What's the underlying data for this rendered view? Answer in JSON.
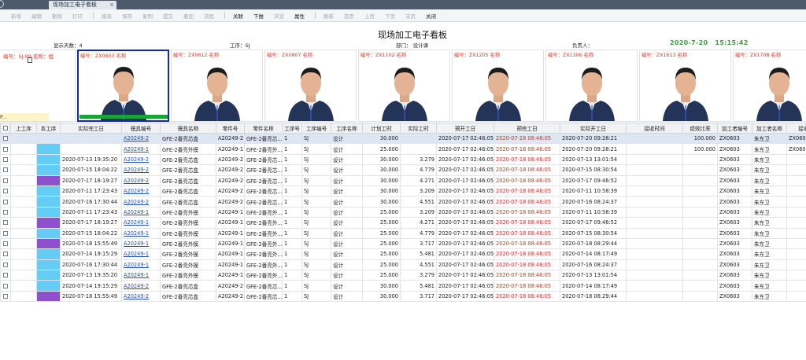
{
  "window": {
    "tab_title": "现场加工电子看板",
    "tab_close": "×"
  },
  "toolbar": {
    "items": [
      {
        "label": "新增",
        "enabled": false
      },
      {
        "label": "编辑",
        "enabled": false
      },
      {
        "label": "删除",
        "enabled": false
      },
      {
        "label": "打印",
        "enabled": false
      },
      {
        "label": "报表",
        "enabled": false
      },
      {
        "label": "保存",
        "enabled": false
      },
      {
        "label": "复制",
        "enabled": false
      },
      {
        "label": "提交",
        "enabled": false
      },
      {
        "label": "撤回",
        "enabled": false
      },
      {
        "label": "流程",
        "enabled": false
      },
      {
        "label": "关联",
        "enabled": true
      },
      {
        "label": "下推",
        "enabled": true
      },
      {
        "label": "浏览",
        "enabled": false
      },
      {
        "label": "属性",
        "enabled": true
      },
      {
        "label": "刷新",
        "enabled": false
      },
      {
        "label": "首页",
        "enabled": false
      },
      {
        "label": "上页",
        "enabled": false
      },
      {
        "label": "下页",
        "enabled": false
      },
      {
        "label": "末页",
        "enabled": false
      },
      {
        "label": "关闭",
        "enabled": true
      }
    ]
  },
  "board": {
    "title": "现场加工电子看板",
    "display_days": "显示天数：4",
    "process": "工序：SJ",
    "department": "部门：  设计课",
    "manager": "负责人：",
    "clock_date": "2020-7-20",
    "clock_time": "15:15:42"
  },
  "employees": [
    {
      "label": "编号：SJ-99 名称：组",
      "bottom_text": "P..."
    },
    {
      "label": "编号：ZX0603 名称",
      "selected": true
    },
    {
      "label": "编号：ZX0612 名称"
    },
    {
      "label": "编号：ZX0807 名称"
    },
    {
      "label": "编号：ZX1102 名称"
    },
    {
      "label": "编号：ZX1205 名称"
    },
    {
      "label": "编号：ZX1306 名称"
    },
    {
      "label": "编号：ZX1613 名称"
    },
    {
      "label": "编号：ZX1708 名称"
    }
  ],
  "table": {
    "columns": [
      "",
      "上工序",
      "本工序",
      "实际完工日",
      "模具编号",
      "模具名称",
      "零件号",
      "零件名称",
      "工序号",
      "工序编号",
      "工序名称",
      "计划工时",
      "实际工时",
      "预开工日",
      "预完工日",
      "实际开工日",
      "接收时间",
      "绩效比率",
      "加工者编号",
      "加工者名称",
      "接收人"
    ],
    "rows": [
      {
        "color": "purple",
        "done": "",
        "mold": "A20249-2",
        "mold_name": "GFE-2番亮芯盒",
        "part": "A20249-2",
        "part_name": "GFE-2番亮芯...",
        "seq": "1",
        "op_code": "SJ",
        "op_name": "设计",
        "plan": "30.000",
        "actual": "",
        "pre_start": "2020-07-17 02:46:05",
        "pre_end": "2020-07-18 08:46:05",
        "act_start": "2020-07-20 09:28:21",
        "recv": "",
        "ratio": "100.000",
        "worker_id": "ZX0603",
        "worker": "朱东卫",
        "receiver": "ZX060"
      },
      {
        "color": "cyan",
        "done": "",
        "mold": "A20249-1",
        "mold_name": "GFE-2番亮外模",
        "part": "A20249-1",
        "part_name": "GFE-2番亮外...",
        "seq": "1",
        "op_code": "SJ",
        "op_name": "设计",
        "plan": "25.000",
        "actual": "",
        "pre_start": "2020-07-17 02:46:05",
        "pre_end": "2020-07-18 08:46:05",
        "act_start": "2020-07-20 09:28:21",
        "recv": "",
        "ratio": "100.000",
        "worker_id": "ZX0603",
        "worker": "朱东卫",
        "receiver": "ZX060"
      },
      {
        "color": "cyan",
        "done": "2020-07-13 19:35:20",
        "mold": "A20249-2",
        "mold_name": "GFE-2番亮芯盒",
        "part": "A20249-2",
        "part_name": "GFE-2番亮芯...",
        "seq": "1",
        "op_code": "SJ",
        "op_name": "设计",
        "plan": "30.000",
        "actual": "3.279",
        "pre_start": "2020-07-17 02:46:05",
        "pre_end": "2020-07-18 08:46:05",
        "act_start": "2020-07-13 13:01:54",
        "recv": "",
        "ratio": "",
        "worker_id": "ZX0603",
        "worker": "朱东卫",
        "receiver": ""
      },
      {
        "color": "cyan",
        "done": "2020-07-15 18:04:22",
        "mold": "A20249-2",
        "mold_name": "GFE-2番亮芯盒",
        "part": "A20249-2",
        "part_name": "GFE-2番亮芯...",
        "seq": "1",
        "op_code": "SJ",
        "op_name": "设计",
        "plan": "30.000",
        "actual": "4.779",
        "pre_start": "2020-07-17 02:46:05",
        "pre_end": "2020-07-18 08:46:05",
        "act_start": "2020-07-15 08:30:54",
        "recv": "",
        "ratio": "",
        "worker_id": "ZX0603",
        "worker": "朱东卫",
        "receiver": ""
      },
      {
        "color": "purple",
        "done": "2020-07-17 18:19:27",
        "mold": "A20249-2",
        "mold_name": "GFE-2番亮芯盒",
        "part": "A20249-2",
        "part_name": "GFE-2番亮芯...",
        "seq": "1",
        "op_code": "SJ",
        "op_name": "设计",
        "plan": "30.000",
        "actual": "4.271",
        "pre_start": "2020-07-17 02:46:05",
        "pre_end": "2020-07-18 08:46:05",
        "act_start": "2020-07-17 09:46:52",
        "recv": "",
        "ratio": "",
        "worker_id": "ZX0603",
        "worker": "朱东卫",
        "receiver": ""
      },
      {
        "color": "cyan",
        "done": "2020-07-11 17:23:43",
        "mold": "A20249-2",
        "mold_name": "GFE-2番亮芯盒",
        "part": "A20249-2",
        "part_name": "GFE-2番亮芯...",
        "seq": "1",
        "op_code": "SJ",
        "op_name": "设计",
        "plan": "30.000",
        "actual": "3.209",
        "pre_start": "2020-07-17 02:46:05",
        "pre_end": "2020-07-18 08:46:05",
        "act_start": "2020-07-11 10:58:39",
        "recv": "",
        "ratio": "",
        "worker_id": "ZX0603",
        "worker": "朱东卫",
        "receiver": ""
      },
      {
        "color": "cyan",
        "done": "2020-07-16 17:30:44",
        "mold": "A20249-2",
        "mold_name": "GFE-2番亮芯盒",
        "part": "A20249-2",
        "part_name": "GFE-2番亮芯...",
        "seq": "1",
        "op_code": "SJ",
        "op_name": "设计",
        "plan": "30.000",
        "actual": "4.551",
        "pre_start": "2020-07-17 02:46:05",
        "pre_end": "2020-07-18 08:46:05",
        "act_start": "2020-07-16 08:24:37",
        "recv": "",
        "ratio": "",
        "worker_id": "ZX0603",
        "worker": "朱东卫",
        "receiver": ""
      },
      {
        "color": "cyan",
        "done": "2020-07-11 17:23:43",
        "mold": "A20249-1",
        "mold_name": "GFE-2番亮外模",
        "part": "A20249-1",
        "part_name": "GFE-2番亮外...",
        "seq": "1",
        "op_code": "SJ",
        "op_name": "设计",
        "plan": "25.000",
        "actual": "3.209",
        "pre_start": "2020-07-17 02:46:05",
        "pre_end": "2020-07-18 08:46:05",
        "act_start": "2020-07-11 10:58:39",
        "recv": "",
        "ratio": "",
        "worker_id": "ZX0603",
        "worker": "朱东卫",
        "receiver": ""
      },
      {
        "color": "purple",
        "done": "2020-07-17 18:19:27",
        "mold": "A20249-1",
        "mold_name": "GFE-2番亮外模",
        "part": "A20249-1",
        "part_name": "GFE-2番亮外...",
        "seq": "1",
        "op_code": "SJ",
        "op_name": "设计",
        "plan": "25.000",
        "actual": "4.271",
        "pre_start": "2020-07-17 02:46:05",
        "pre_end": "2020-07-18 08:46:05",
        "act_start": "2020-07-17 09:46:52",
        "recv": "",
        "ratio": "",
        "worker_id": "ZX0603",
        "worker": "朱东卫",
        "receiver": ""
      },
      {
        "color": "cyan",
        "done": "2020-07-15 18:04:22",
        "mold": "A20249-1",
        "mold_name": "GFE-2番亮外模",
        "part": "A20249-1",
        "part_name": "GFE-2番亮外...",
        "seq": "1",
        "op_code": "SJ",
        "op_name": "设计",
        "plan": "25.000",
        "actual": "4.779",
        "pre_start": "2020-07-17 02:46:05",
        "pre_end": "2020-07-18 08:46:05",
        "act_start": "2020-07-15 08:30:54",
        "recv": "",
        "ratio": "",
        "worker_id": "ZX0603",
        "worker": "朱东卫",
        "receiver": ""
      },
      {
        "color": "purple",
        "done": "2020-07-18 15:55:49",
        "mold": "A20249-1",
        "mold_name": "GFE-2番亮外模",
        "part": "A20249-1",
        "part_name": "GFE-2番亮外...",
        "seq": "1",
        "op_code": "SJ",
        "op_name": "设计",
        "plan": "25.000",
        "actual": "3.717",
        "pre_start": "2020-07-17 02:46:05",
        "pre_end": "2020-07-18 08:46:05",
        "act_start": "2020-07-18 08:29:44",
        "recv": "",
        "ratio": "",
        "worker_id": "ZX0603",
        "worker": "朱东卫",
        "receiver": ""
      },
      {
        "color": "cyan",
        "done": "2020-07-14 19:15:29",
        "mold": "A20249-1",
        "mold_name": "GFE-2番亮外模",
        "part": "A20249-1",
        "part_name": "GFE-2番亮外...",
        "seq": "1",
        "op_code": "SJ",
        "op_name": "设计",
        "plan": "25.000",
        "actual": "5.481",
        "pre_start": "2020-07-17 02:46:05",
        "pre_end": "2020-07-18 08:46:05",
        "act_start": "2020-07-14 08:17:49",
        "recv": "",
        "ratio": "",
        "worker_id": "ZX0603",
        "worker": "朱东卫",
        "receiver": ""
      },
      {
        "color": "cyan",
        "done": "2020-07-16 17:30:44",
        "mold": "A20249-1",
        "mold_name": "GFE-2番亮外模",
        "part": "A20249-1",
        "part_name": "GFE-2番亮外...",
        "seq": "1",
        "op_code": "SJ",
        "op_name": "设计",
        "plan": "25.000",
        "actual": "4.551",
        "pre_start": "2020-07-17 02:46:05",
        "pre_end": "2020-07-18 08:46:05",
        "act_start": "2020-07-16 08:24:37",
        "recv": "",
        "ratio": "",
        "worker_id": "ZX0603",
        "worker": "朱东卫",
        "receiver": ""
      },
      {
        "color": "cyan",
        "done": "2020-07-13 19:35:20",
        "mold": "A20249-1",
        "mold_name": "GFE-2番亮外模",
        "part": "A20249-1",
        "part_name": "GFE-2番亮外...",
        "seq": "1",
        "op_code": "SJ",
        "op_name": "设计",
        "plan": "25.000",
        "actual": "3.279",
        "pre_start": "2020-07-17 02:46:05",
        "pre_end": "2020-07-18 08:46:05",
        "act_start": "2020-07-13 13:01:54",
        "recv": "",
        "ratio": "",
        "worker_id": "ZX0603",
        "worker": "朱东卫",
        "receiver": ""
      },
      {
        "color": "cyan",
        "done": "2020-07-14 19:15:29",
        "mold": "A20249-2",
        "mold_name": "GFE-2番亮芯盒",
        "part": "A20249-2",
        "part_name": "GFE-2番亮芯...",
        "seq": "1",
        "op_code": "SJ",
        "op_name": "设计",
        "plan": "30.000",
        "actual": "5.481",
        "pre_start": "2020-07-17 02:46:05",
        "pre_end": "2020-07-18 08:46:05",
        "act_start": "2020-07-14 08:17:49",
        "recv": "",
        "ratio": "",
        "worker_id": "ZX0603",
        "worker": "朱东卫",
        "receiver": ""
      },
      {
        "color": "purple",
        "done": "2020-07-18 15:55:49",
        "mold": "A20249-2",
        "mold_name": "GFE-2番亮芯盒",
        "part": "A20249-2",
        "part_name": "GFE-2番亮芯...",
        "seq": "1",
        "op_code": "SJ",
        "op_name": "设计",
        "plan": "30.000",
        "actual": "3.717",
        "pre_start": "2020-07-17 02:46:05",
        "pre_end": "2020-07-18 08:46:05",
        "act_start": "2020-07-18 08:29:44",
        "recv": "",
        "ratio": "",
        "worker_id": "ZX0603",
        "worker": "朱东卫",
        "receiver": ""
      }
    ]
  }
}
